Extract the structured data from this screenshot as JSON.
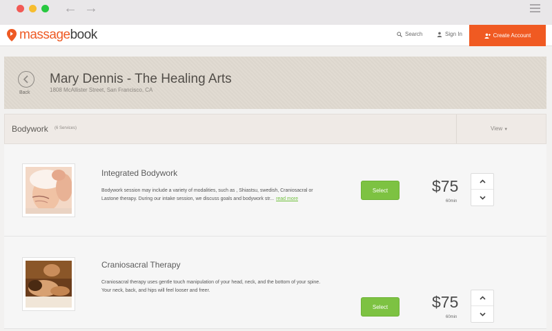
{
  "window": {
    "controls": [
      "close",
      "minimize",
      "maximize"
    ],
    "back_icon": "arrow-left-icon",
    "forward_icon": "arrow-right-icon",
    "menu_icon": "hamburger-icon"
  },
  "header": {
    "logo_part1": "massage",
    "logo_part2": "book",
    "search_label": "Search",
    "signin_label": "Sign In",
    "create_account_label": "Create Account",
    "accent_color": "#f05a22"
  },
  "hero": {
    "back_label": "Back",
    "title": "Mary Dennis - The Healing Arts",
    "address": "1808 McAllister Street, San Francisco, CA"
  },
  "section": {
    "title": "Bodywork",
    "count": "(6 Services)",
    "view_label": "View"
  },
  "services": [
    {
      "name": "Integrated Bodywork",
      "description": "Bodywork session may include a variety of modalities, such as , Shiastsu, swedish, Craniosacral or Lastone therapy. During our intake session, we discuss goals and bodywork str...",
      "read_more": "read more",
      "select_label": "Select",
      "price": "$75",
      "duration": "60min"
    },
    {
      "name": "Craniosacral Therapy",
      "description": "Craniosacral therapy uses gentle touch manipulation of your head, neck, and the bottom of your spine. Your neck, back, and hips will feel looser and freer.",
      "select_label": "Select",
      "price": "$75",
      "duration": "60min"
    }
  ],
  "colors": {
    "select_green": "#7dc242",
    "read_more_green": "#6ebf3a"
  }
}
